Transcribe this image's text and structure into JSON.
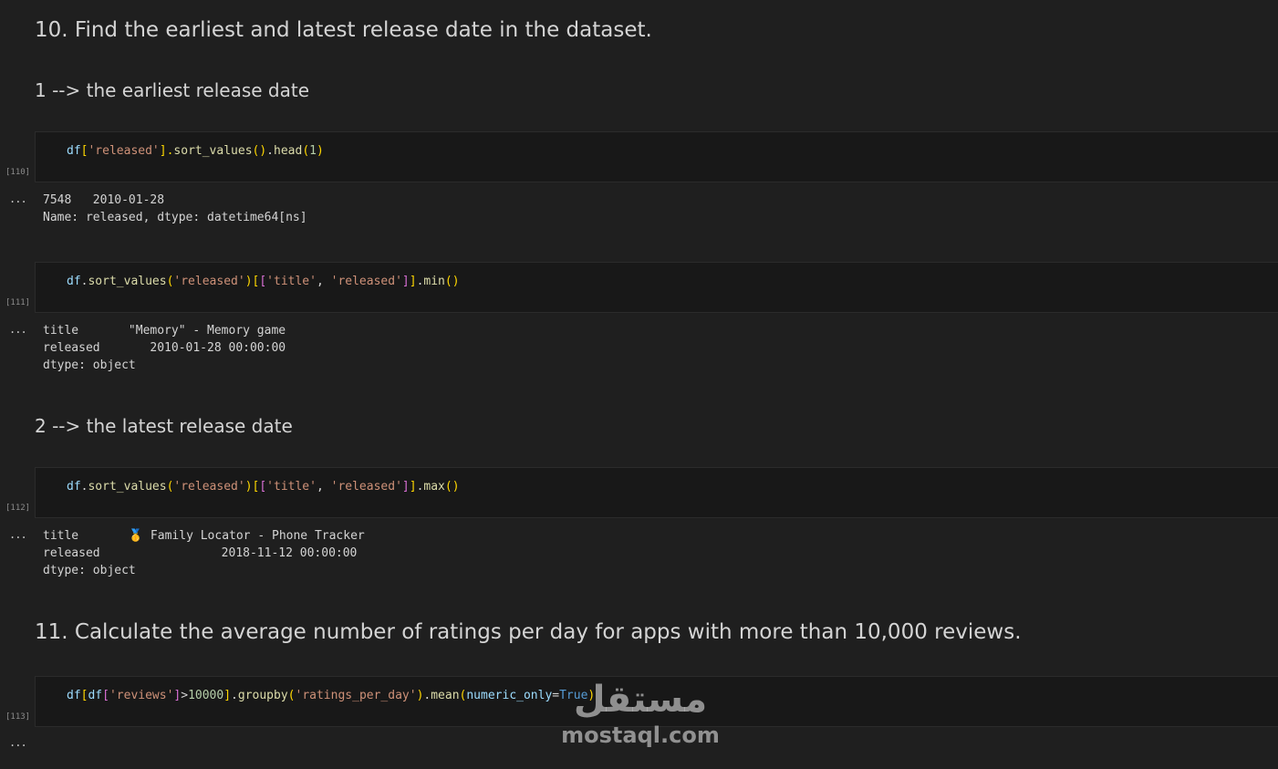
{
  "markdown": {
    "q10_heading": "10. Find the earliest and latest release date in the dataset.",
    "earliest_heading": "1 --> the earliest release date",
    "latest_heading": "2 --> the latest release date",
    "q11_heading": "11. Calculate the average number of ratings per day for apps with more than 10,000 reviews."
  },
  "cells": [
    {
      "exec_count": "[110]",
      "code": {
        "t1": "df",
        "t2": "[",
        "t3": "'released'",
        "t4": "].",
        "t5": "sort_values",
        "t6": "()",
        "t7": ".",
        "t8": "head",
        "t9": "(",
        "t10": "1",
        "t11": ")"
      },
      "output": "7548   2010-01-28\nName: released, dtype: datetime64[ns]"
    },
    {
      "exec_count": "[111]",
      "code": {
        "t1": "df",
        "t2": ".",
        "t3": "sort_values",
        "t4": "(",
        "t5": "'released'",
        "t6": ")",
        "t7": "[",
        "t8": "[",
        "t9": "'title'",
        "t10": ", ",
        "t11": "'released'",
        "t12": "]",
        "t13": "]",
        "t14": ".",
        "t15": "min",
        "t16": "()"
      },
      "output": "title       \"Memory\" - Memory game\nreleased       2010-01-28 00:00:00\ndtype: object"
    },
    {
      "exec_count": "[112]",
      "code": {
        "t1": "df",
        "t2": ".",
        "t3": "sort_values",
        "t4": "(",
        "t5": "'released'",
        "t6": ")",
        "t7": "[",
        "t8": "[",
        "t9": "'title'",
        "t10": ", ",
        "t11": "'released'",
        "t12": "]",
        "t13": "]",
        "t14": ".",
        "t15": "max",
        "t16": "()"
      },
      "output_title_label": "title       ",
      "output_medal": "🥇",
      "output_title_value": " Family Locator - Phone Tracker",
      "output_rest": "released                 2018-11-12 00:00:00\ndtype: object"
    },
    {
      "exec_count": "[113]",
      "code": {
        "t1": "df",
        "t2": "[",
        "t3": "df",
        "t4": "[",
        "t5": "'reviews'",
        "t6": "]",
        "t7": ">",
        "t8": "10000",
        "t9": "]",
        "t10": ".",
        "t11": "groupby",
        "t12": "(",
        "t13": "'ratings_per_day'",
        "t14": ")",
        "t15": ".",
        "t16": "mean",
        "t17": "(",
        "t18": "numeric_only",
        "t19": "=",
        "t20": "True",
        "t21": ")"
      }
    }
  ],
  "output_indicator": "...",
  "watermark": {
    "arabic": "مستقل",
    "latin": "mostaql.com"
  }
}
